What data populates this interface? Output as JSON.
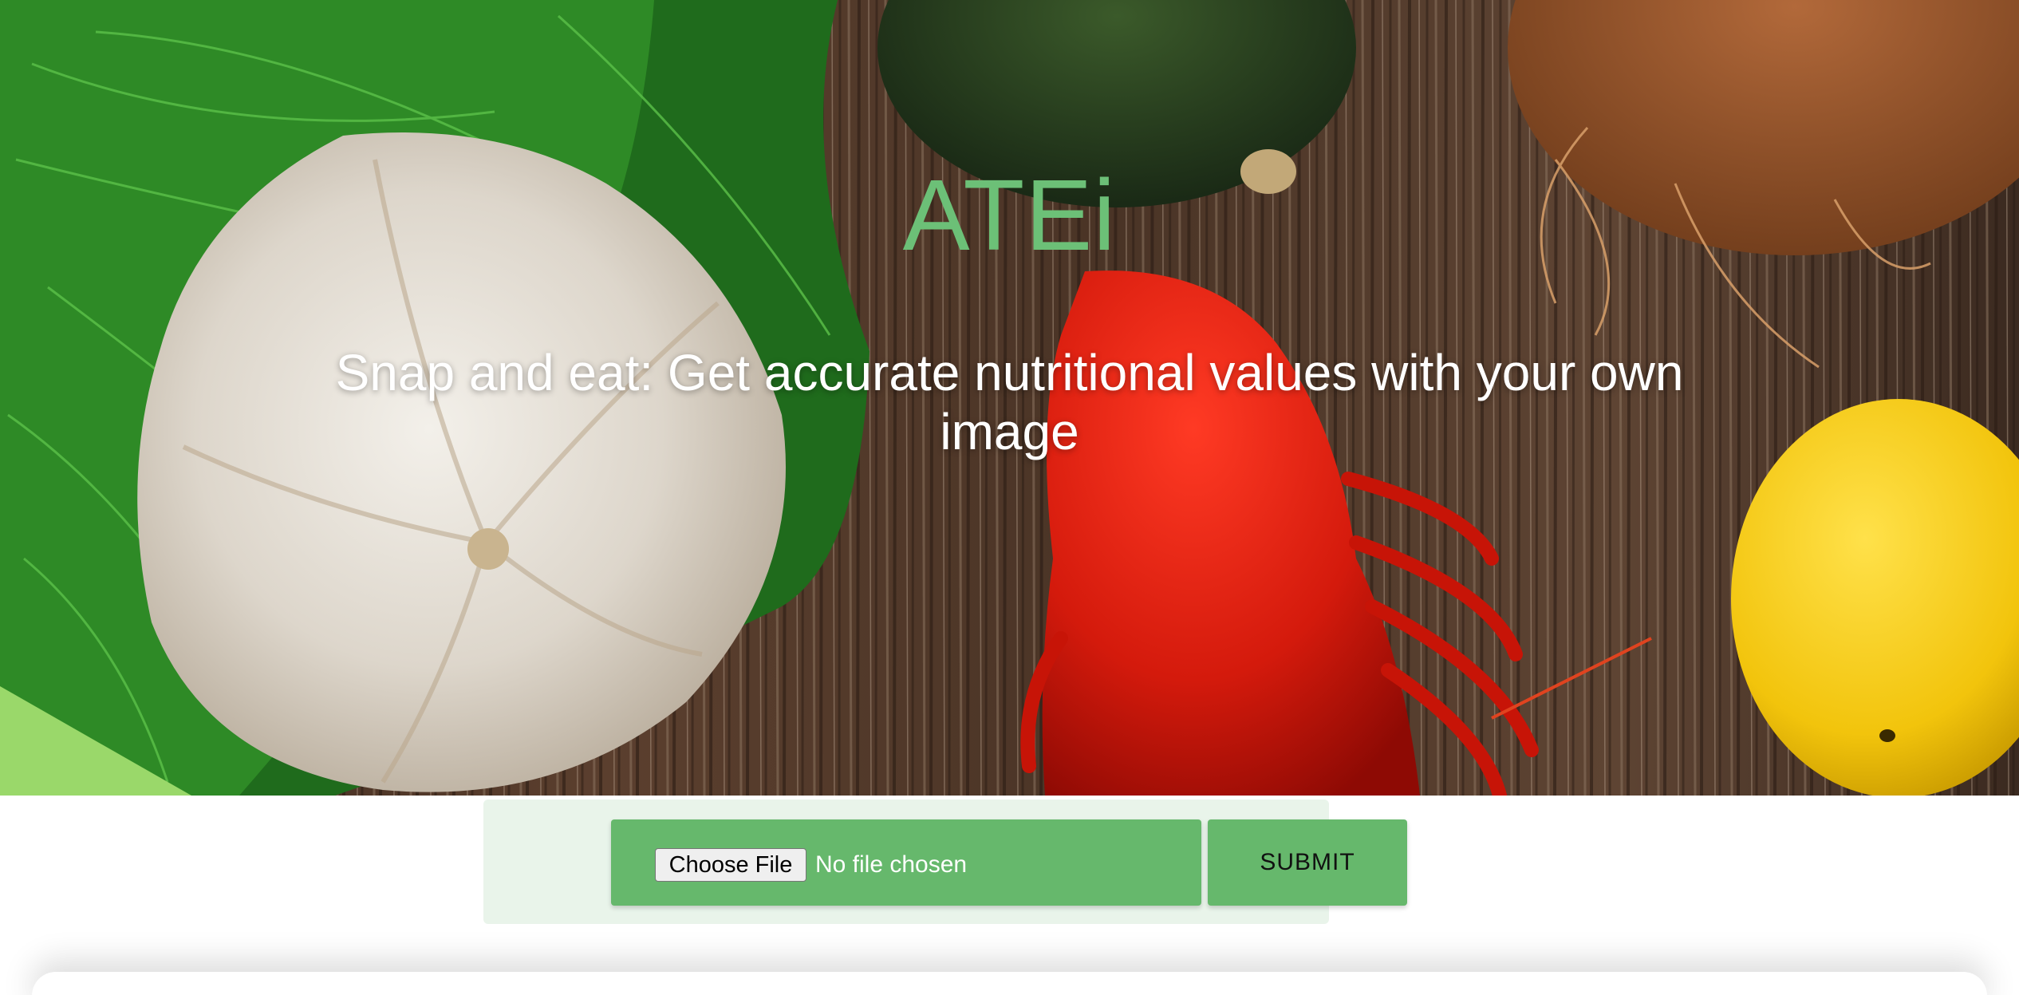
{
  "hero": {
    "title": "ATEi",
    "subtitle": "Snap and eat: Get accurate nutritional values with your own image"
  },
  "upload": {
    "choose_file_label": "Choose File",
    "file_status": "No file chosen",
    "submit_label": "SUBMIT"
  },
  "colors": {
    "accent": "#66b86c",
    "title": "#6cc077",
    "panel": "#e9f4ea"
  },
  "icons": [
    "garlic-illustration",
    "dill-illustration",
    "crayfish-illustration",
    "lemon-illustration",
    "avocado-illustration",
    "coconut-illustration"
  ]
}
